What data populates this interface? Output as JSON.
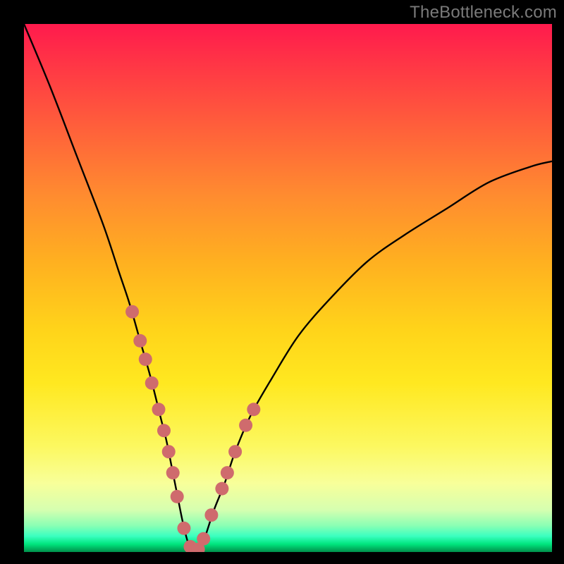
{
  "watermark": "TheBottleneck.com",
  "chart_data": {
    "type": "line",
    "title": "",
    "xlabel": "",
    "ylabel": "",
    "xlim": [
      0,
      100
    ],
    "ylim": [
      0,
      100
    ],
    "grid": false,
    "series": [
      {
        "name": "bottleneck-curve",
        "x": [
          0,
          5,
          10,
          15,
          18,
          20,
          22,
          24,
          26,
          27,
          28,
          29,
          30,
          31,
          32,
          33,
          34,
          36,
          38,
          40,
          43,
          47,
          52,
          58,
          65,
          72,
          80,
          88,
          96,
          100
        ],
        "values": [
          100,
          88,
          75,
          62,
          53,
          47,
          40,
          33,
          25,
          21,
          16,
          11,
          6,
          2,
          0,
          0,
          2,
          8,
          13,
          19,
          26,
          33,
          41,
          48,
          55,
          60,
          65,
          70,
          73,
          74
        ]
      }
    ],
    "markers": {
      "name": "highlight-dots",
      "color": "#cf6b6d",
      "x": [
        20.5,
        22.0,
        23.0,
        24.2,
        25.5,
        26.5,
        27.4,
        28.2,
        29.0,
        30.3,
        31.5,
        33.0,
        34.0,
        35.5,
        37.5,
        38.5,
        40.0,
        42.0,
        43.5
      ],
      "values": [
        45.5,
        40.0,
        36.5,
        32.0,
        27.0,
        23.0,
        19.0,
        15.0,
        10.5,
        4.5,
        1.0,
        0.5,
        2.5,
        7.0,
        12.0,
        15.0,
        19.0,
        24.0,
        27.0
      ]
    },
    "gradient_stops": [
      {
        "pos": 0,
        "color": "#ff1a4d"
      },
      {
        "pos": 18,
        "color": "#ff5a3c"
      },
      {
        "pos": 45,
        "color": "#ffb020"
      },
      {
        "pos": 68,
        "color": "#ffe820"
      },
      {
        "pos": 87,
        "color": "#f8ff9a"
      },
      {
        "pos": 95,
        "color": "#8affb4"
      },
      {
        "pos": 100,
        "color": "#008f4a"
      }
    ]
  }
}
